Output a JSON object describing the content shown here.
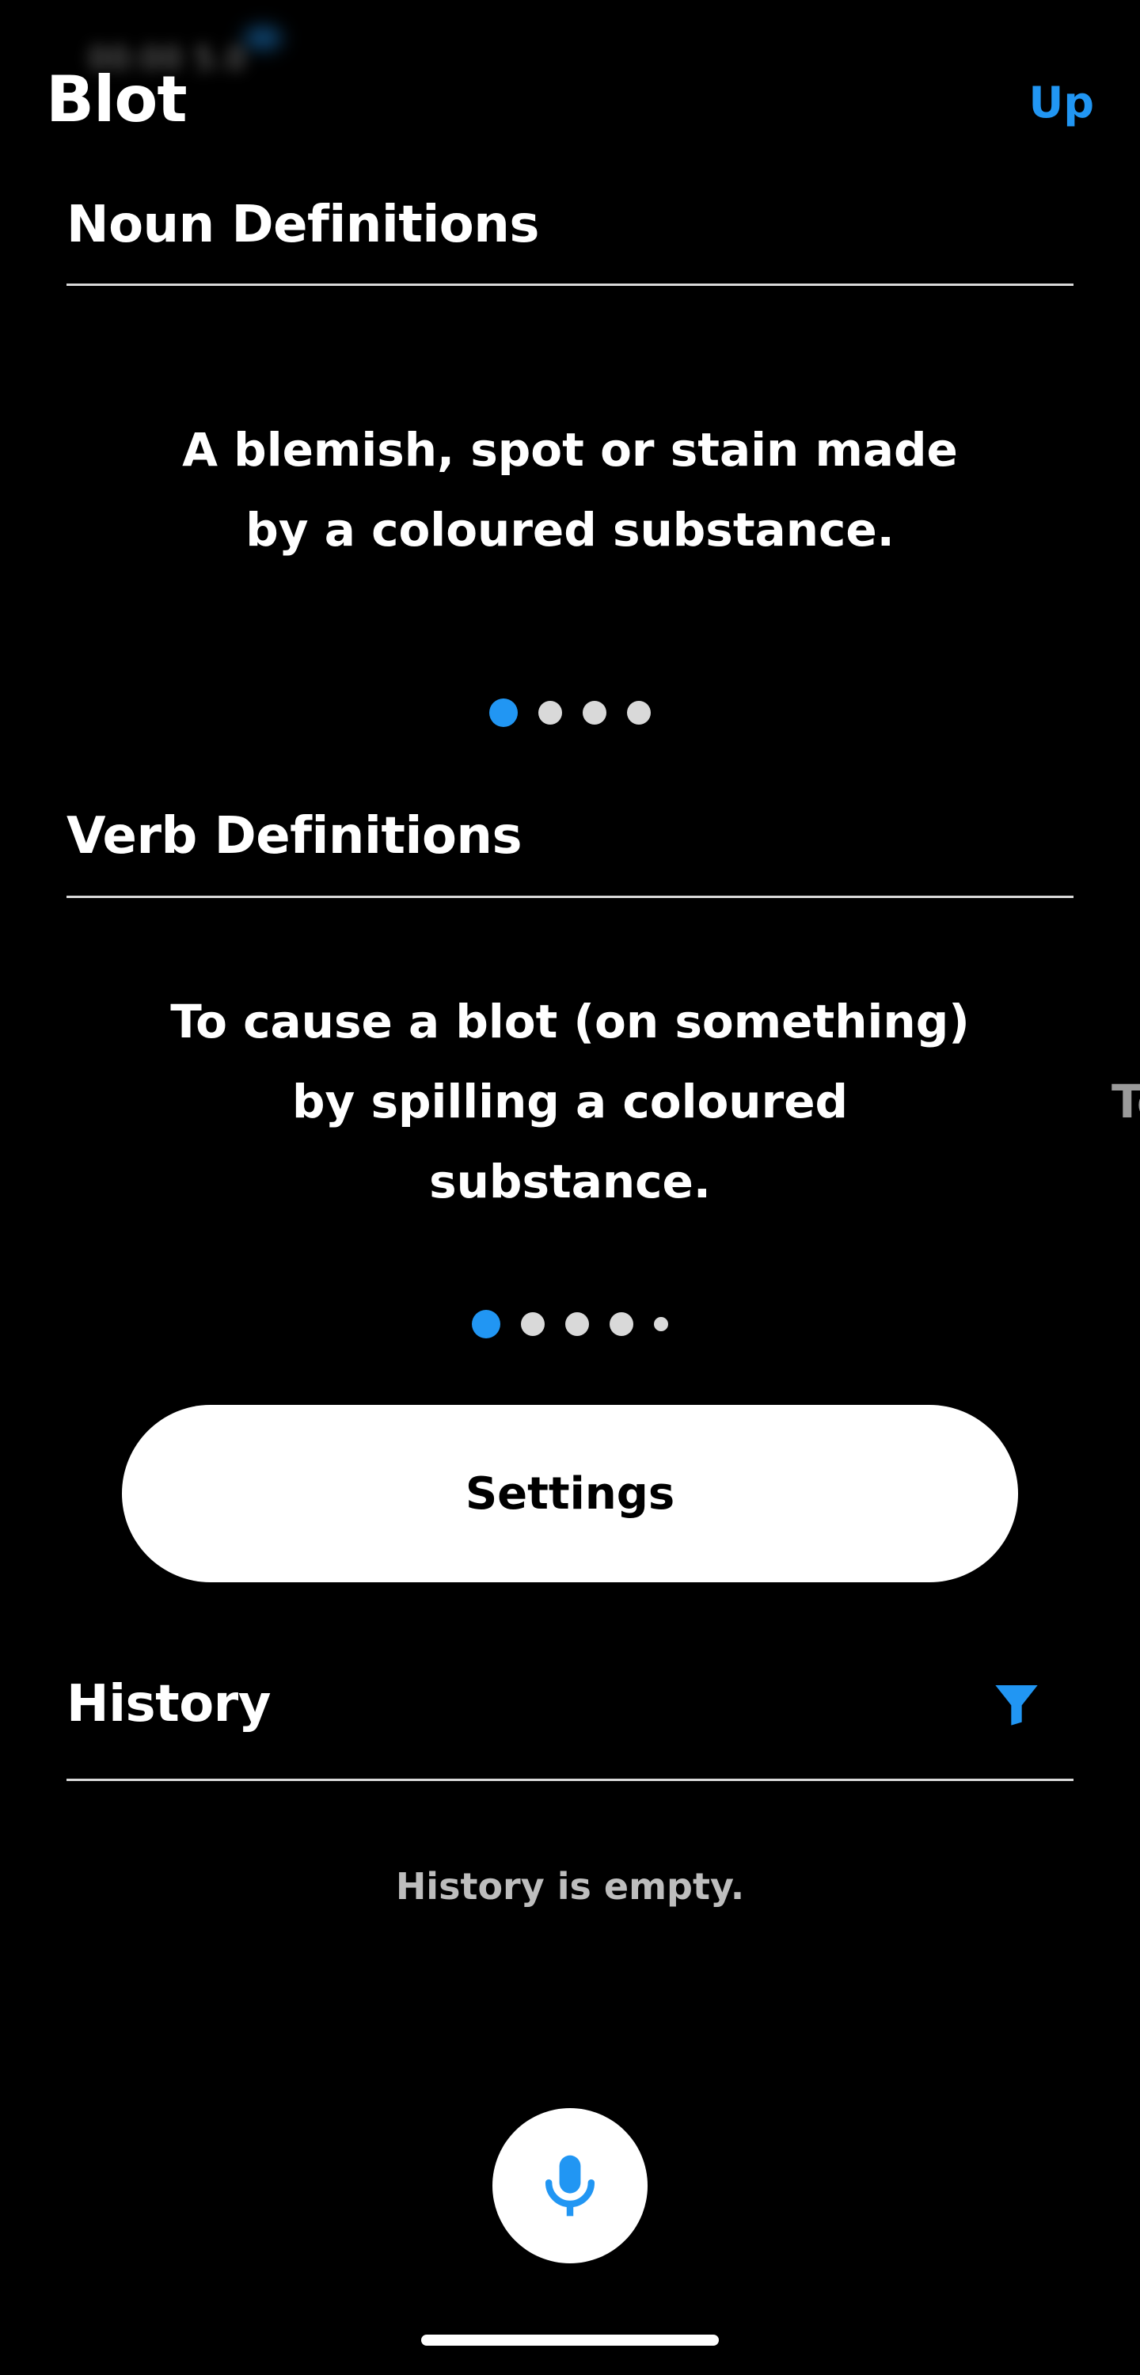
{
  "status_bar": {
    "time_blurred": "00:00 5.0"
  },
  "header": {
    "title": "Blot",
    "up_label": "Up"
  },
  "noun_section": {
    "title": "Noun Definitions",
    "definition_line1": "A blemish, spot or stain made",
    "definition_line2": "by a coloured substance.",
    "page_count": 4,
    "active_page": 1
  },
  "verb_section": {
    "title": "Verb Definitions",
    "definition_line1": "To cause a blot (on something)",
    "definition_line2": "by spilling a coloured",
    "definition_line3": "substance.",
    "next_card_peek": "To",
    "page_count": 5,
    "active_page": 1
  },
  "settings": {
    "label": "Settings"
  },
  "history": {
    "title": "History",
    "empty_text": "History is empty.",
    "filter_icon": "filter-icon"
  },
  "mic": {
    "icon": "microphone-icon"
  },
  "colors": {
    "accent": "#2196f3",
    "background": "#000000",
    "text": "#ffffff",
    "muted_text": "#bdbdbd"
  }
}
